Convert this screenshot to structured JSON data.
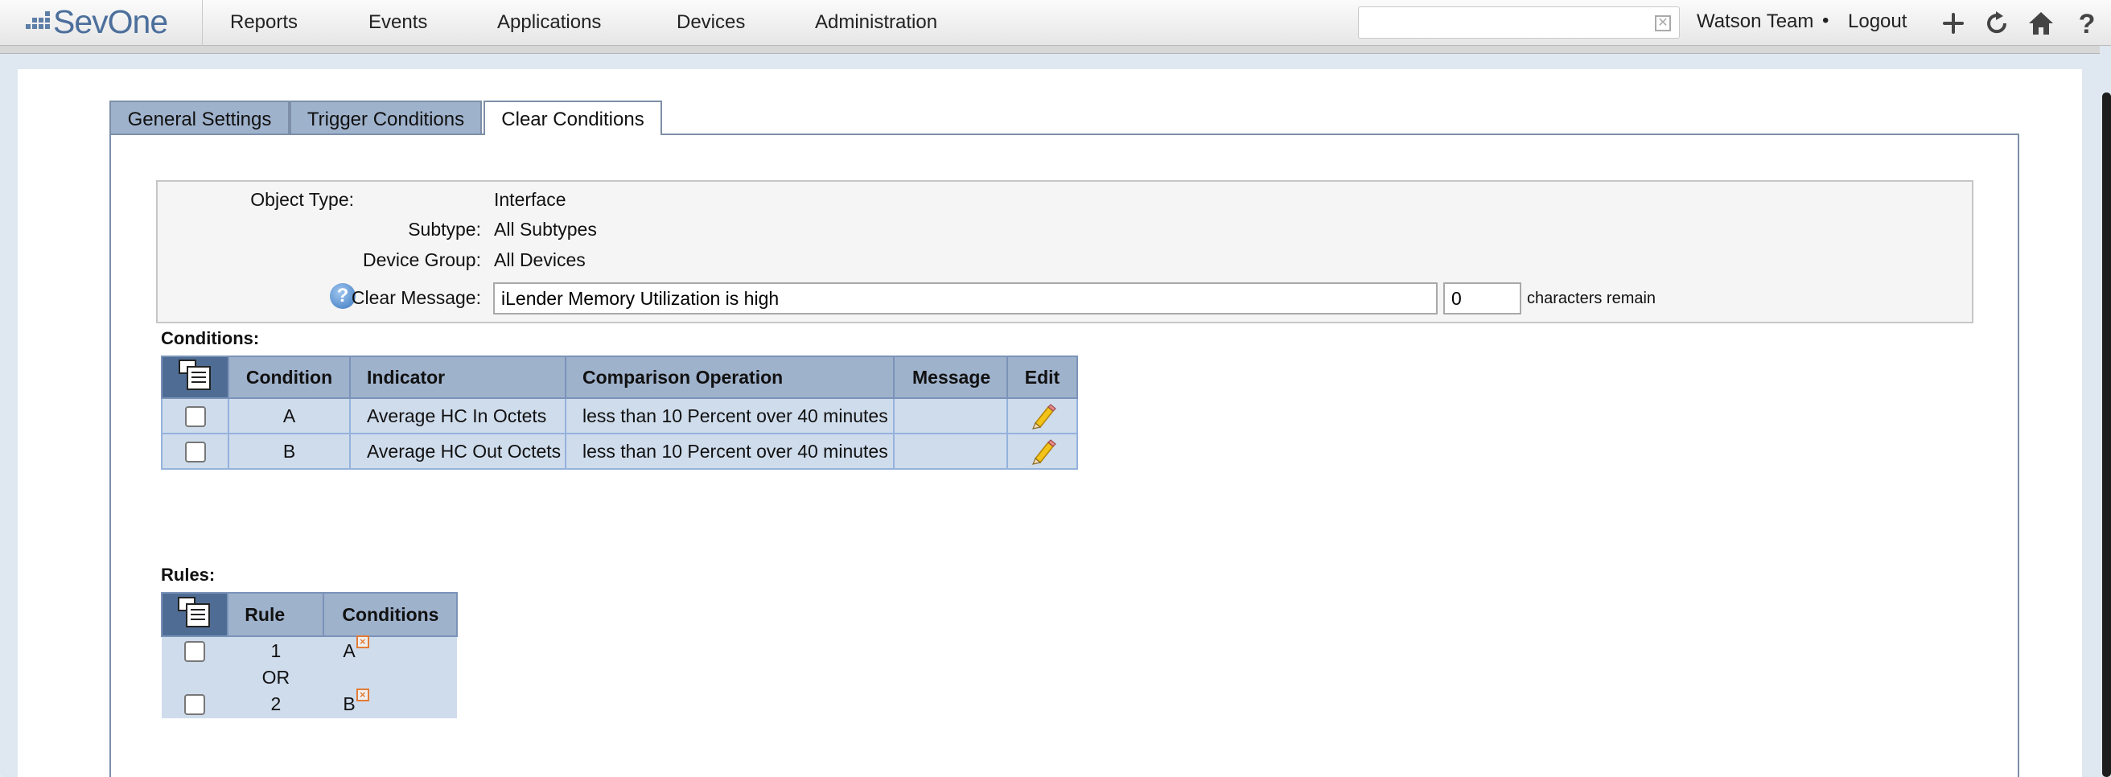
{
  "nav": {
    "brand": "SevOne",
    "items": [
      "Reports",
      "Events",
      "Applications",
      "Devices",
      "Administration"
    ],
    "search_value": "",
    "user": "Watson Team",
    "separator": "•",
    "logout": "Logout"
  },
  "tabs": [
    {
      "label": "General Settings",
      "active": false
    },
    {
      "label": "Trigger Conditions",
      "active": false
    },
    {
      "label": "Clear Conditions",
      "active": true
    }
  ],
  "info": {
    "object_type_label": "Object Type:",
    "object_type_value": "Interface",
    "subtype_label": "Subtype:",
    "subtype_value": "All Subtypes",
    "device_group_label": "Device Group:",
    "device_group_value": "All Devices",
    "clear_message_label": "Clear Message:",
    "clear_message_value": "iLender Memory Utilization is high",
    "chars_remaining_value": "0",
    "chars_remaining_label": "characters remain"
  },
  "conditions": {
    "title": "Conditions:",
    "headers": [
      "Condition",
      "Indicator",
      "Comparison Operation",
      "Message",
      "Edit"
    ],
    "rows": [
      {
        "condition": "A",
        "indicator": "Average HC In Octets",
        "comparison": "less than 10 Percent over 40 minutes",
        "message": ""
      },
      {
        "condition": "B",
        "indicator": "Average HC Out Octets",
        "comparison": "less than 10 Percent over 40 minutes",
        "message": ""
      }
    ]
  },
  "rules": {
    "title": "Rules:",
    "headers": [
      "Rule",
      "Conditions"
    ],
    "rows": [
      {
        "rule": "1",
        "conditions": "A"
      },
      {
        "rule": "2",
        "conditions": "B"
      }
    ],
    "joiner": "OR"
  },
  "colors": {
    "header_bg": "#9fb2cc",
    "cell_bg": "#cfdcec",
    "brand": "#4c6f9c",
    "remove_icon": "#e27b35"
  }
}
